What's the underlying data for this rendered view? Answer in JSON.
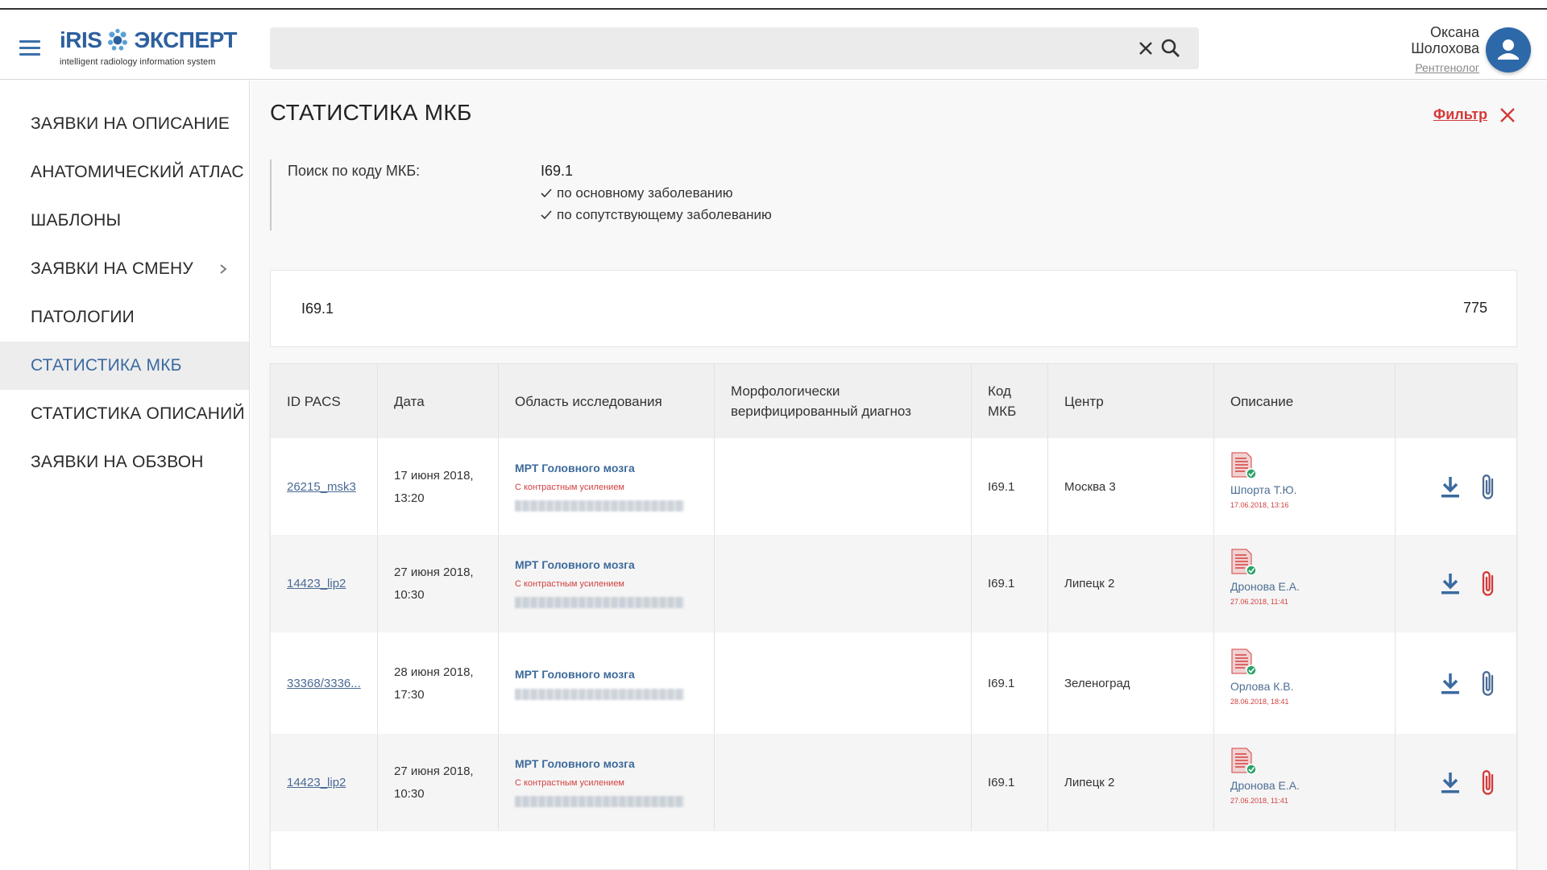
{
  "header": {
    "logo_iris": "iRIS",
    "logo_ekspert": "ЭКСПЕРТ",
    "logo_sub": "intelligent radiology information system",
    "search_value": "",
    "user_first": "Оксана",
    "user_last": "Шолохова",
    "user_role": "Рентгенолог"
  },
  "sidebar": {
    "items": [
      {
        "label": "ЗАЯВКИ НА ОПИСАНИЕ"
      },
      {
        "label": "АНАТОМИЧЕСКИЙ АТЛАС"
      },
      {
        "label": "ШАБЛОНЫ"
      },
      {
        "label": "ЗАЯВКИ НА СМЕНУ"
      },
      {
        "label": "ПАТОЛОГИИ"
      },
      {
        "label": "СТАТИСТИКА МКБ"
      },
      {
        "label": "СТАТИСТИКА ОПИСАНИЙ"
      },
      {
        "label": "ЗАЯВКИ НА ОБЗВОН"
      }
    ],
    "active_index": 5
  },
  "page": {
    "title": "СТАТИСТИКА МКБ",
    "filter_label": "Фильтр"
  },
  "criteria": {
    "label": "Поиск по коду МКБ:",
    "code": "I69.1",
    "options": [
      "по основному заболеванию",
      "по сопутствующему заболеванию"
    ]
  },
  "summary": {
    "code": "I69.1",
    "count": "775"
  },
  "table": {
    "headers": {
      "id": "ID PACS",
      "date": "Дата",
      "area": "Область исследования",
      "morph_1": "Морфологически",
      "morph_2": "верифицированный диагноз",
      "mkb_1": "Код",
      "mkb_2": "МКБ",
      "center": "Центр",
      "desc": "Описание"
    },
    "rows": [
      {
        "id": "26215_msk3",
        "date_1": "17 июня 2018,",
        "date_2": "13:20",
        "area_title": "МРТ Головного мозга",
        "area_sub": "С контрастным усилением",
        "mkb": "I69.1",
        "center": "Москва 3",
        "author": "Шпорта Т.Ю.",
        "doc_date": "17.06.2018, 13:16",
        "clip_color": "#4a6a94"
      },
      {
        "id": "14423_lip2",
        "date_1": "27 июня 2018,",
        "date_2": "10:30",
        "area_title": "МРТ Головного мозга",
        "area_sub": "С контрастным усилением",
        "mkb": "I69.1",
        "center": "Липецк 2",
        "author": "Дронова Е.А.",
        "doc_date": "27.06.2018, 11:41",
        "clip_color": "#d33a3a"
      },
      {
        "id": "33368/3336...",
        "date_1": "28 июня 2018,",
        "date_2": "17:30",
        "area_title": "МРТ Головного мозга",
        "area_sub": "",
        "mkb": "I69.1",
        "center": "Зеленоград",
        "author": "Орлова К.В.",
        "doc_date": "28.06.2018, 18:41",
        "clip_color": "#4a6a94"
      },
      {
        "id": "14423_lip2",
        "date_1": "27 июня 2018,",
        "date_2": "10:30",
        "area_title": "МРТ Головного мозга",
        "area_sub": "С контрастным усилением",
        "mkb": "I69.1",
        "center": "Липецк 2",
        "author": "Дронова Е.А.",
        "doc_date": "27.06.2018, 11:41",
        "clip_color": "#d33a3a"
      }
    ]
  }
}
